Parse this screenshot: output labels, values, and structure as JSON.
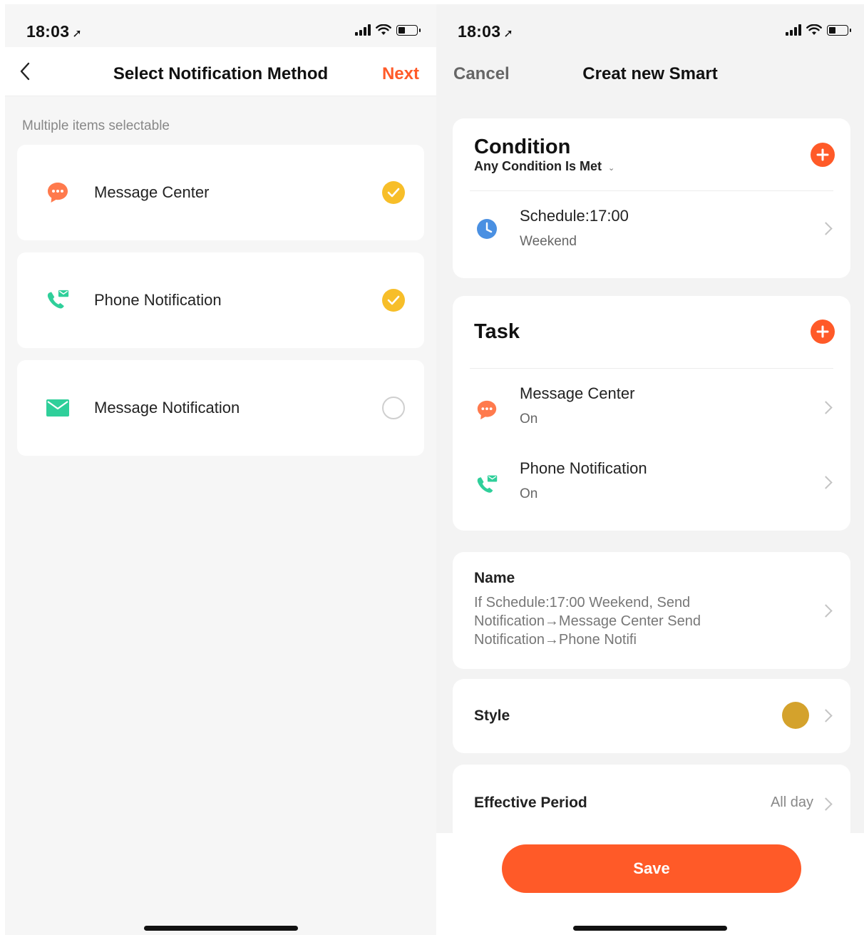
{
  "left": {
    "status": {
      "time": "18:03"
    },
    "header": {
      "title": "Select Notification Method",
      "next_label": "Next"
    },
    "hint": "Multiple items selectable",
    "options": [
      {
        "label": "Message Center",
        "icon": "chat-bubble-icon",
        "checked": true
      },
      {
        "label": "Phone Notification",
        "icon": "phone-message-icon",
        "checked": true
      },
      {
        "label": "Message Notification",
        "icon": "envelope-icon",
        "checked": false
      }
    ]
  },
  "right": {
    "status": {
      "time": "18:03"
    },
    "header": {
      "cancel_label": "Cancel",
      "title": "Creat new Smart"
    },
    "condition": {
      "title": "Condition",
      "mode": "Any Condition Is Met",
      "items": [
        {
          "title": "Schedule:17:00",
          "sub": "Weekend",
          "icon": "clock-icon"
        }
      ]
    },
    "task": {
      "title": "Task",
      "items": [
        {
          "title": "Message Center",
          "sub": "On",
          "icon": "chat-bubble-icon"
        },
        {
          "title": "Phone Notification",
          "sub": "On",
          "icon": "phone-message-icon"
        }
      ]
    },
    "name": {
      "label": "Name",
      "value": "If Schedule:17:00 Weekend, Send Notification→Message Center Send Notification→Phone Notifi"
    },
    "style": {
      "label": "Style",
      "color": "#d4a22c"
    },
    "period": {
      "label": "Effective Period",
      "value": "All day"
    },
    "save_label": "Save"
  },
  "colors": {
    "accent": "#ff5a28",
    "check": "#f7be29",
    "teal": "#2fcf9a",
    "clock": "#4a90e2"
  }
}
